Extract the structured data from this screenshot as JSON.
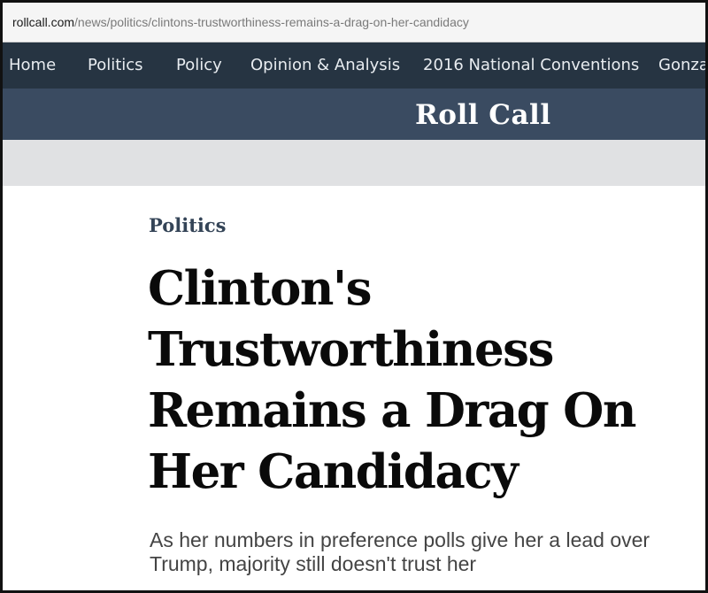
{
  "browser": {
    "url_domain": "rollcall.com",
    "url_path": "/news/politics/clintons-trustworthiness-remains-a-drag-on-her-candidacy"
  },
  "nav": {
    "items": [
      "Home",
      "Politics",
      "Policy",
      "Opinion & Analysis",
      "2016 National Conventions",
      "Gonza"
    ]
  },
  "brand": {
    "logo_text": "Roll Call"
  },
  "article": {
    "section": "Politics",
    "headline_lines": [
      "Clinton's",
      "Trustworthiness",
      "Remains a Drag On",
      "Her Candidacy"
    ],
    "dek_lines": [
      "As her numbers in preference polls give her a lead over",
      "Trump, majority still doesn't trust her"
    ]
  },
  "colors": {
    "nav_bg": "#263442",
    "brand_bg": "#3a4b61",
    "strip_bg": "#e0e1e3",
    "section_label": "#344457"
  }
}
